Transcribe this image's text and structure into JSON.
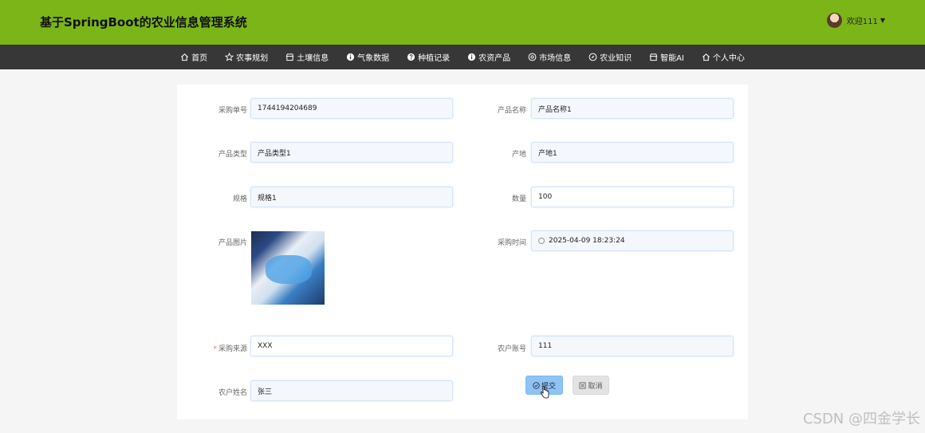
{
  "header": {
    "title": "基于SpringBoot的农业信息管理系统",
    "user_greeting": "欢迎111",
    "brand_color": "#7cb518"
  },
  "nav": [
    {
      "label": "首页",
      "icon": "home-icon"
    },
    {
      "label": "农事规划",
      "icon": "star-icon"
    },
    {
      "label": "土壤信息",
      "icon": "shop-icon"
    },
    {
      "label": "气象数据",
      "icon": "info-icon"
    },
    {
      "label": "种植记录",
      "icon": "question-icon"
    },
    {
      "label": "农资产品",
      "icon": "info-icon"
    },
    {
      "label": "市场信息",
      "icon": "at-icon"
    },
    {
      "label": "农业知识",
      "icon": "compass-icon"
    },
    {
      "label": "智能AI",
      "icon": "shop-icon"
    },
    {
      "label": "个人中心",
      "icon": "home-icon"
    }
  ],
  "form": {
    "order_no": {
      "label": "采购单号",
      "value": "1744194204689"
    },
    "product_name": {
      "label": "产品名称",
      "value": "产品名称1"
    },
    "product_type": {
      "label": "产品类型",
      "value": "产品类型1"
    },
    "origin": {
      "label": "产地",
      "value": "产地1"
    },
    "spec": {
      "label": "规格",
      "value": "规格1"
    },
    "quantity": {
      "label": "数量",
      "value": "100"
    },
    "product_image": {
      "label": "产品图片"
    },
    "purchase_time": {
      "label": "采购时间",
      "value": "2025-04-09 18:23:24"
    },
    "source": {
      "label": "采购来源",
      "value": "XXX",
      "required_mark": "*"
    },
    "farmer_account": {
      "label": "农户账号",
      "value": "111"
    },
    "farmer_name": {
      "label": "农户姓名",
      "value": "张三"
    }
  },
  "buttons": {
    "submit": "提交",
    "cancel": "取消"
  },
  "watermark": "CSDN @四金学长"
}
